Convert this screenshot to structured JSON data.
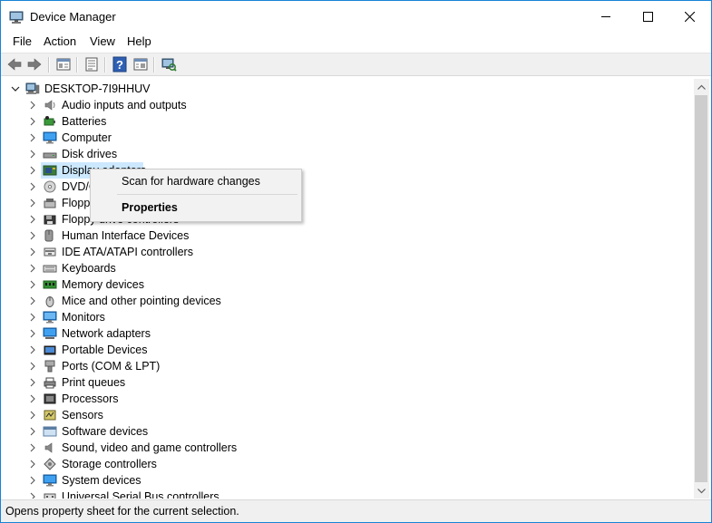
{
  "window": {
    "title": "Device Manager",
    "controls": {
      "minimize_icon": "minimize-icon",
      "maximize_icon": "maximize-icon",
      "close_icon": "close-icon"
    }
  },
  "menubar": {
    "items": [
      {
        "label": "File"
      },
      {
        "label": "Action"
      },
      {
        "label": "View"
      },
      {
        "label": "Help"
      }
    ]
  },
  "toolbar": {
    "buttons": [
      {
        "icon": "back-arrow-icon"
      },
      {
        "icon": "forward-arrow-icon"
      },
      {
        "icon": "show-hide-console-tree-icon"
      },
      {
        "icon": "properties-sheet-icon"
      },
      {
        "icon": "help-icon"
      },
      {
        "icon": "update-driver-icon"
      },
      {
        "icon": "scan-hardware-changes-icon"
      }
    ]
  },
  "tree": {
    "root": {
      "label": "DESKTOP-7I9HHUV",
      "icon": "computer-icon"
    },
    "categories": [
      {
        "label": "Audio inputs and outputs",
        "icon": "speaker-icon"
      },
      {
        "label": "Batteries",
        "icon": "battery-icon"
      },
      {
        "label": "Computer",
        "icon": "computer-monitor-icon"
      },
      {
        "label": "Disk drives",
        "icon": "disk-drive-icon"
      },
      {
        "label": "Display adapters",
        "icon": "display-adapter-icon"
      },
      {
        "label": "DVD/CD-ROM drives",
        "icon": "dvd-drive-icon"
      },
      {
        "label": "Floppy disk drives",
        "icon": "floppy-disk-icon"
      },
      {
        "label": "Floppy drive controllers",
        "icon": "floppy-controller-icon"
      },
      {
        "label": "Human Interface Devices",
        "icon": "hid-icon"
      },
      {
        "label": "IDE ATA/ATAPI controllers",
        "icon": "ide-controller-icon"
      },
      {
        "label": "Keyboards",
        "icon": "keyboard-icon"
      },
      {
        "label": "Memory devices",
        "icon": "memory-icon"
      },
      {
        "label": "Mice and other pointing devices",
        "icon": "mouse-icon"
      },
      {
        "label": "Monitors",
        "icon": "monitor-icon"
      },
      {
        "label": "Network adapters",
        "icon": "network-adapter-icon"
      },
      {
        "label": "Portable Devices",
        "icon": "portable-device-icon"
      },
      {
        "label": "Ports (COM & LPT)",
        "icon": "port-icon"
      },
      {
        "label": "Print queues",
        "icon": "printer-icon"
      },
      {
        "label": "Processors",
        "icon": "processor-icon"
      },
      {
        "label": "Sensors",
        "icon": "sensor-icon"
      },
      {
        "label": "Software devices",
        "icon": "software-device-icon"
      },
      {
        "label": "Sound, video and game controllers",
        "icon": "sound-controller-icon"
      },
      {
        "label": "Storage controllers",
        "icon": "storage-controller-icon"
      },
      {
        "label": "System devices",
        "icon": "system-device-icon"
      },
      {
        "label": "Universal Serial Bus controllers",
        "icon": "usb-icon"
      }
    ],
    "selected_index": 4
  },
  "context_menu": {
    "items": [
      {
        "label": "Scan for hardware changes",
        "bold": false
      },
      {
        "label": "Properties",
        "bold": true
      }
    ]
  },
  "statusbar": {
    "text": "Opens property sheet for the current selection."
  },
  "colors": {
    "accent_border": "#1883d7",
    "selection": "#cce8ff",
    "toolbar_bg": "#f0f0f0"
  }
}
